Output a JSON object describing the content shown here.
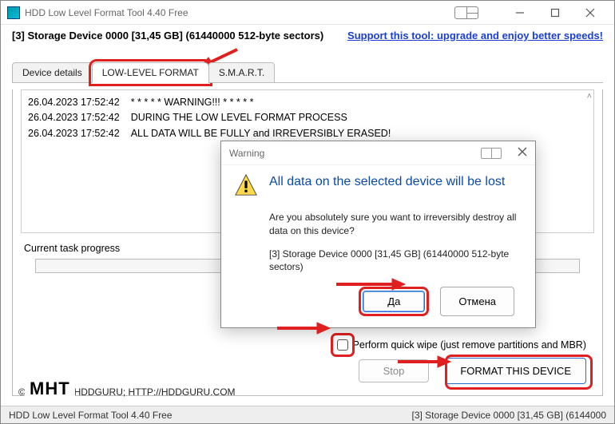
{
  "window": {
    "title": "HDD Low Level Format Tool 4.40   Free"
  },
  "device_header": {
    "text": "[3]  Storage Device   0000   [31,45 GB]   (61440000 512-byte sectors)",
    "support_link": "Support this tool: upgrade and enjoy better speeds!"
  },
  "tabs": {
    "device_details": "Device details",
    "low_level_format": "LOW-LEVEL FORMAT",
    "smart": "S.M.A.R.T."
  },
  "log": {
    "timestamp": "26.04.2023 17:52:42",
    "l1": "* * * * *  WARNING!!! * * * * *",
    "l2": "DURING THE LOW LEVEL FORMAT PROCESS",
    "l3": "ALL DATA WILL BE FULLY and IRREVERSIBLY ERASED!"
  },
  "progress_label": "Current task progress",
  "quick_wipe_label": "Perform quick wipe (just remove partitions and MBR)",
  "buttons": {
    "stop": "Stop",
    "format": "FORMAT THIS DEVICE"
  },
  "copyright": "©2005-2013 HDDGURU;   HTTP://HDDGURU.COM",
  "mht": "MHT",
  "statusbar": {
    "left": "HDD Low Level Format Tool 4.40   Free",
    "right": "[3]  Storage Device   0000   [31,45 GB]   (6144000"
  },
  "modal": {
    "title": "Warning",
    "headline": "All data on the selected device will be lost",
    "text": "Are you absolutely sure you want to irreversibly destroy all data on this device?",
    "device": "[3]  Storage Device   0000   [31,45 GB]   (61440000 512-byte sectors)",
    "yes": "Да",
    "cancel": "Отмена"
  }
}
